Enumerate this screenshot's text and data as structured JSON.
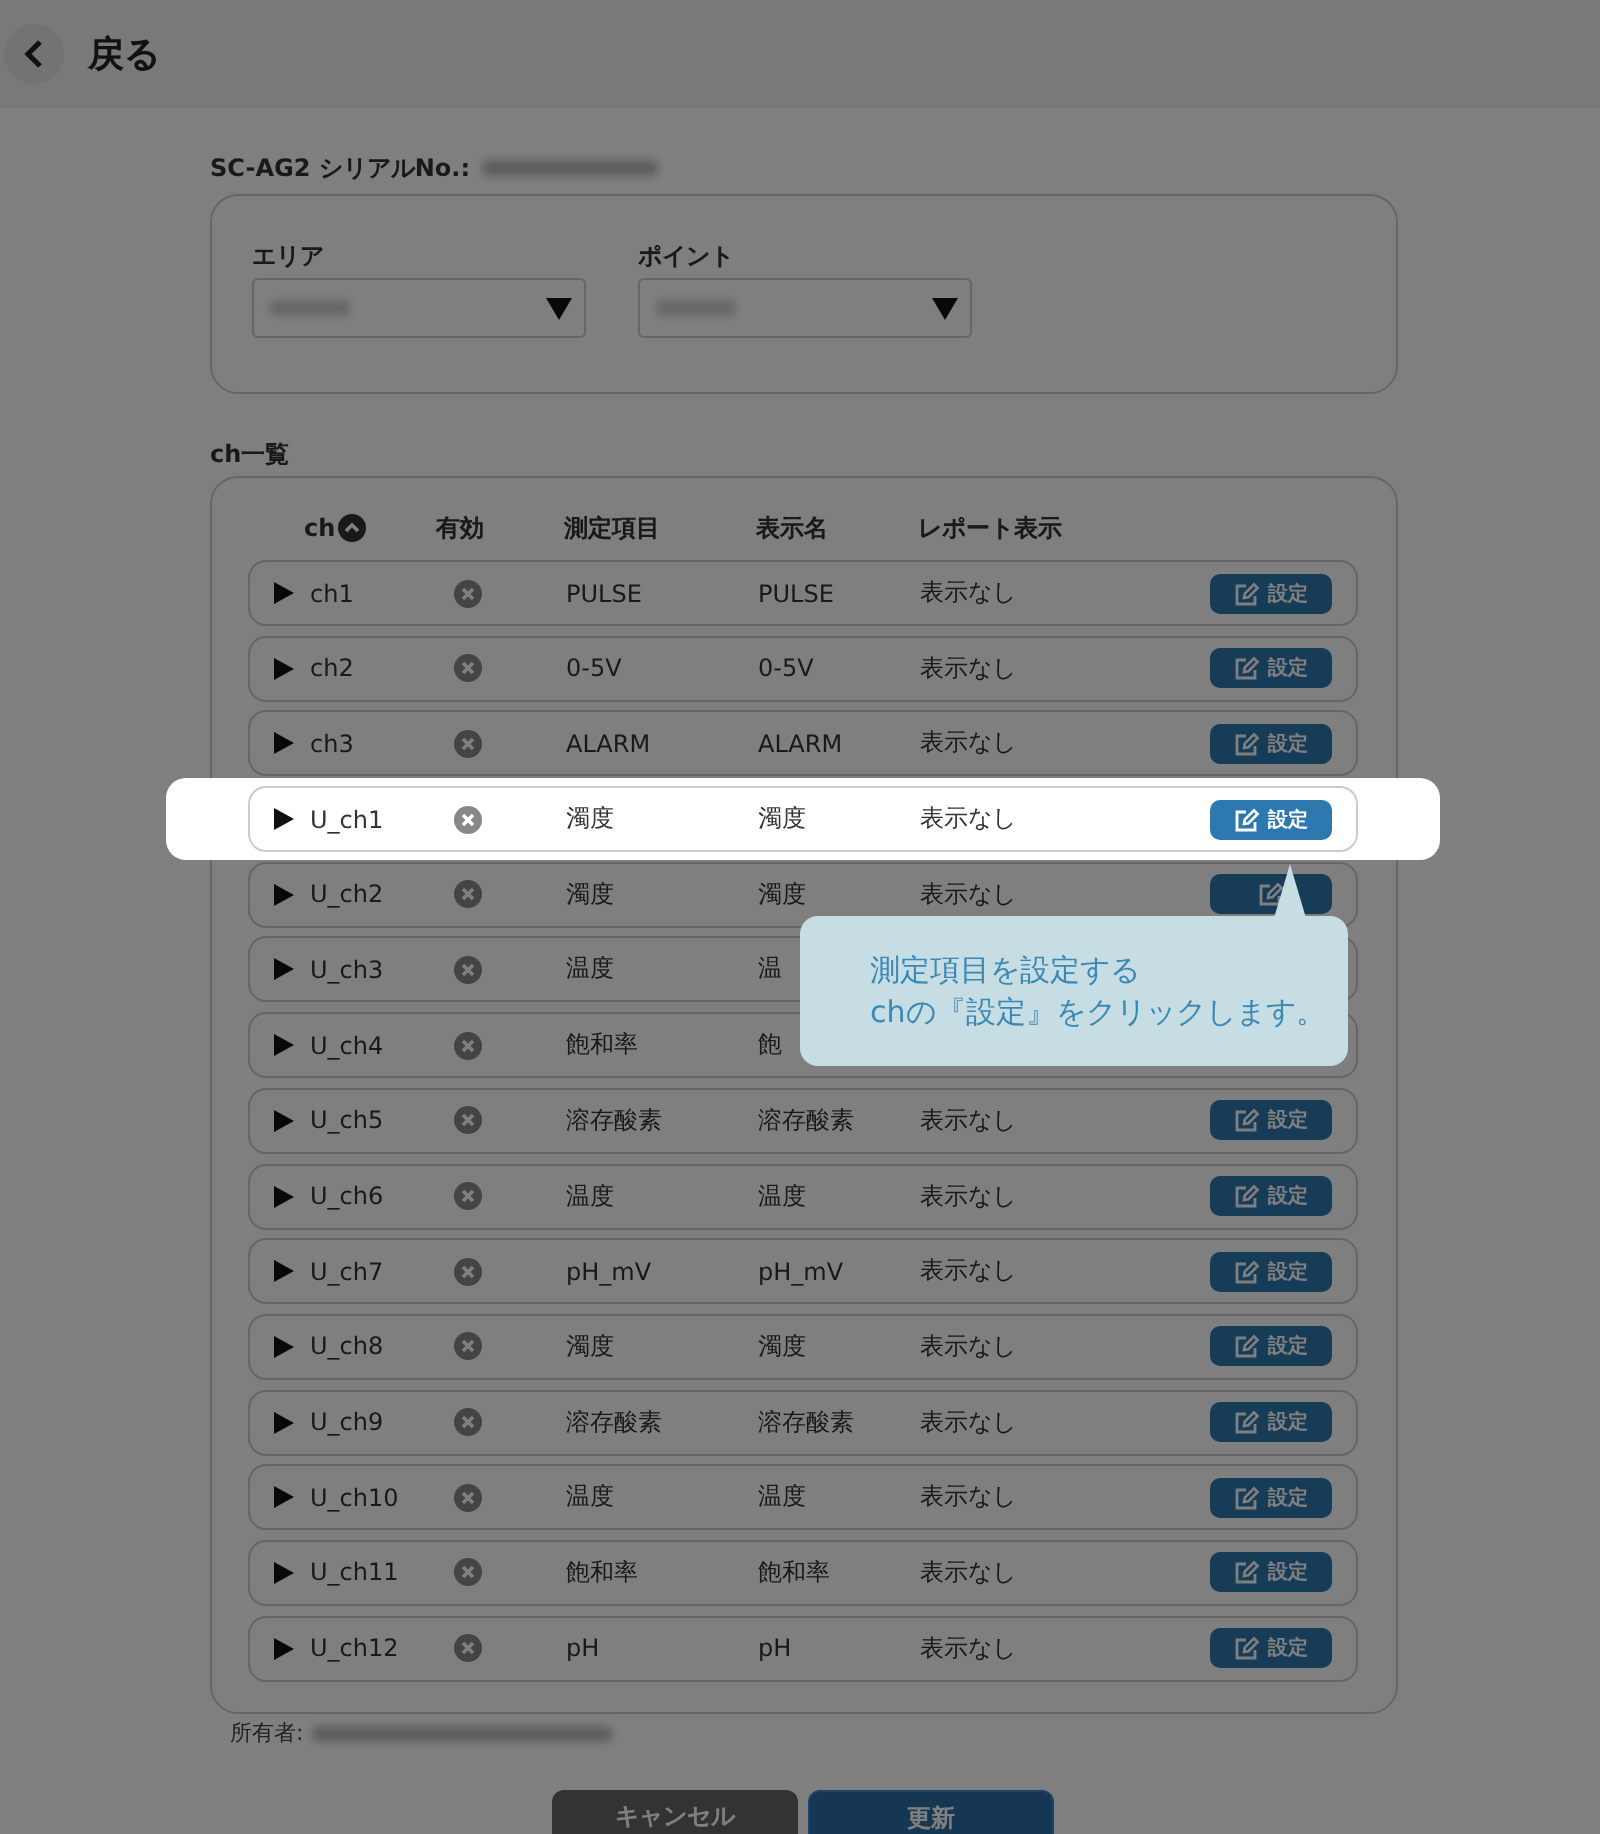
{
  "header": {
    "back_label": "戻る"
  },
  "device": {
    "serial_label": "SC-AG2 シリアルNo.:"
  },
  "filters": [
    {
      "label": "エリア"
    },
    {
      "label": "ポイント"
    }
  ],
  "channel_list": {
    "title": "ch一覧",
    "columns": [
      "ch",
      "有効",
      "測定項目",
      "表示名",
      "レポート表示"
    ],
    "rows": [
      {
        "ch": "ch1",
        "expanded": false,
        "enabled": false,
        "measure": "PULSE",
        "display_name": "PULSE",
        "report": "表示なし",
        "action": "設定",
        "highlighted": false
      },
      {
        "ch": "ch2",
        "expanded": false,
        "enabled": false,
        "measure": "0-5V",
        "display_name": "0-5V",
        "report": "表示なし",
        "action": "設定",
        "highlighted": false
      },
      {
        "ch": "ch3",
        "expanded": false,
        "enabled": false,
        "measure": "ALARM",
        "display_name": "ALARM",
        "report": "表示なし",
        "action": "設定",
        "highlighted": false
      },
      {
        "ch": "U_ch1",
        "expanded": false,
        "enabled": false,
        "measure": "濁度",
        "display_name": "濁度",
        "report": "表示なし",
        "action": "設定",
        "highlighted": true
      },
      {
        "ch": "U_ch2",
        "expanded": false,
        "enabled": false,
        "measure": "濁度",
        "display_name": "濁度",
        "report": "表示なし",
        "button": true,
        "highlighted": false
      },
      {
        "ch": "U_ch3",
        "expanded": false,
        "enabled": false,
        "measure": "温度",
        "display_name": "温",
        "highlighted": false
      },
      {
        "ch": "U_ch4",
        "expanded": false,
        "enabled": false,
        "measure": "飽和率",
        "display_name": "飽",
        "highlighted": false
      },
      {
        "ch": "U_ch5",
        "expanded": false,
        "enabled": false,
        "measure": "溶存酸素",
        "display_name": "溶存酸素",
        "report": "表示なし",
        "action": "設定",
        "highlighted": false
      },
      {
        "ch": "U_ch6",
        "expanded": false,
        "enabled": false,
        "measure": "温度",
        "display_name": "温度",
        "report": "表示なし",
        "action": "設定",
        "highlighted": false
      },
      {
        "ch": "U_ch7",
        "expanded": false,
        "enabled": false,
        "measure": "pH_mV",
        "display_name": "pH_mV",
        "report": "表示なし",
        "action": "設定",
        "highlighted": false
      },
      {
        "ch": "U_ch8",
        "expanded": false,
        "enabled": false,
        "measure": "濁度",
        "display_name": "濁度",
        "report": "表示なし",
        "action": "設定",
        "highlighted": false
      },
      {
        "ch": "U_ch9",
        "expanded": false,
        "enabled": false,
        "measure": "溶存酸素",
        "display_name": "溶存酸素",
        "report": "表示なし",
        "action": "設定",
        "highlighted": false
      },
      {
        "ch": "U_ch10",
        "expanded": false,
        "enabled": false,
        "measure": "温度",
        "display_name": "温度",
        "report": "表示なし",
        "action": "設定",
        "highlighted": false
      },
      {
        "ch": "U_ch11",
        "expanded": false,
        "enabled": false,
        "measure": "飽和率",
        "display_name": "飽和率",
        "report": "表示なし",
        "action": "設定",
        "highlighted": false
      },
      {
        "ch": "U_ch12",
        "expanded": false,
        "enabled": false,
        "measure": "pH",
        "display_name": "pH",
        "report": "表示なし",
        "action": "設定",
        "highlighted": false
      }
    ]
  },
  "owner_label": "所有者:",
  "buttons": [
    {
      "label": "キャンセル",
      "kind": "cancel"
    },
    {
      "label": "更新",
      "kind": "primary"
    }
  ],
  "callout": {
    "text": "測定項目を設定する\nchの『設定』をクリックします。"
  }
}
